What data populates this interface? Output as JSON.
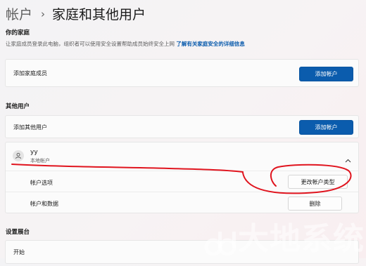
{
  "breadcrumb": {
    "parent": "帐户",
    "separator": "›",
    "current": "家庭和其他用户"
  },
  "family": {
    "title": "你的家庭",
    "description": "让家庭成员登录此电脑，组织者可以使用安全设置帮助成员始终安全上网",
    "link": "了解有关家庭安全的详细信息",
    "add_label": "添加家庭成员",
    "add_button": "添加帐户"
  },
  "others": {
    "title": "其他用户",
    "add_label": "添加其他用户",
    "add_button": "添加帐户",
    "user": {
      "name": "yy",
      "type": "本地帐户",
      "options_label": "帐户选项",
      "change_type_button": "更改帐户类型",
      "data_label": "帐户和数据",
      "delete_button": "删除"
    }
  },
  "kiosk": {
    "title": "设置展台",
    "start_label": "开始"
  },
  "watermark": "大地系统",
  "colors": {
    "accent": "#0b5cad",
    "annotation": "#e0141e"
  },
  "icons": {
    "avatar": "person-icon",
    "expand": "chevron-up-icon",
    "watermark_logo": "dd-logo-icon"
  }
}
